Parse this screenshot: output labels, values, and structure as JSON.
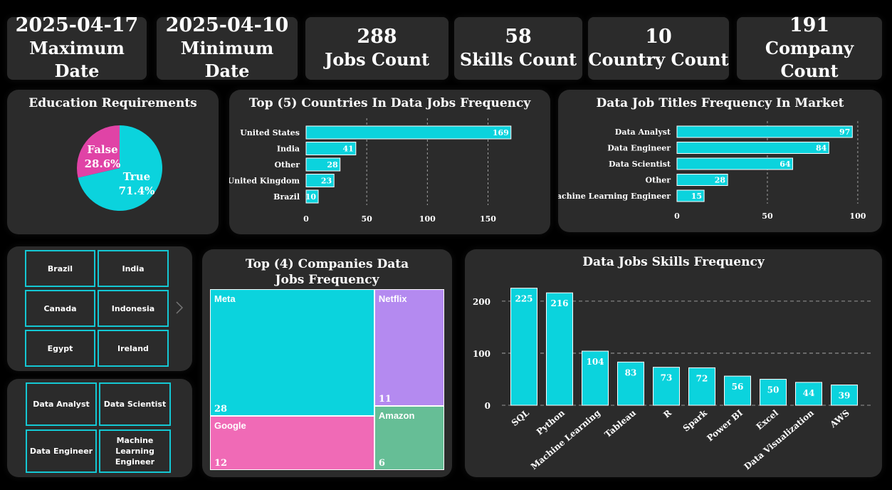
{
  "kpis": [
    {
      "value": "2025-04-17",
      "label": "Maximum Date"
    },
    {
      "value": "2025-04-10",
      "label": "Minimum Date"
    },
    {
      "value": "288",
      "label": "Jobs Count"
    },
    {
      "value": "58",
      "label": "Skills Count"
    },
    {
      "value": "10",
      "label": "Country Count"
    },
    {
      "value": "191",
      "label": "Company Count"
    }
  ],
  "panels": {
    "education": "Education Requirements",
    "countries": "Top (5) Countries In Data Jobs Frequency",
    "titles": "Data Job Titles Frequency In Market",
    "companies": "Top (4) Companies Data Jobs Frequency",
    "skills": "Data Jobs Skills Frequency"
  },
  "country_slicer": [
    "Brazil",
    "India",
    "Canada",
    "Indonesia",
    "Egypt",
    "Ireland"
  ],
  "title_slicer": [
    "Data Analyst",
    "Data Scientist",
    "Data Engineer",
    "Machine Learning Engineer"
  ],
  "colors": {
    "cyan": "#0bd3dd",
    "pink": "#e043a6",
    "purple": "#b48af0",
    "treepink": "#f06ab6",
    "green": "#66be96",
    "card": "#2b2b2b",
    "border": "#14c8d4"
  },
  "chart_data": [
    {
      "type": "pie",
      "title": "Education Requirements",
      "labels": [
        "True",
        "False"
      ],
      "values": [
        71.4,
        28.6
      ],
      "value_labels": [
        "71.4%",
        "28.6%"
      ]
    },
    {
      "type": "bar",
      "orientation": "horizontal",
      "title": "Top (5) Countries In Data Jobs Frequency",
      "categories": [
        "United States",
        "India",
        "Other",
        "United Kingdom",
        "Brazil"
      ],
      "values": [
        169,
        41,
        28,
        23,
        10
      ],
      "xlim": [
        0,
        175
      ],
      "ticks": [
        "0",
        "50",
        "100",
        "150"
      ],
      "grid": true
    },
    {
      "type": "bar",
      "orientation": "horizontal",
      "title": "Data Job Titles Frequency In Market",
      "categories": [
        "Data Analyst",
        "Data Engineer",
        "Data Scientist",
        "Other",
        "Machine Learning Engineer"
      ],
      "values": [
        97,
        84,
        64,
        28,
        15
      ],
      "xlim": [
        0,
        102
      ],
      "ticks": [
        "0",
        "50",
        "100"
      ],
      "grid": true
    },
    {
      "type": "treemap",
      "title": "Top (4) Companies Data Jobs Frequency",
      "categories": [
        "Meta",
        "Google",
        "Netflix",
        "Amazon"
      ],
      "values": [
        28,
        12,
        11,
        6
      ]
    },
    {
      "type": "bar",
      "title": "Data Jobs Skills Frequency",
      "categories": [
        "SQL",
        "Python",
        "Machine Learning",
        "Tableau",
        "R",
        "Spark",
        "Power BI",
        "Excel",
        "Data Visualization",
        "AWS"
      ],
      "values": [
        225,
        216,
        104,
        83,
        73,
        72,
        56,
        50,
        44,
        39
      ],
      "ylim": [
        0,
        245
      ],
      "ticks": [
        "0",
        "100",
        "200"
      ],
      "grid": true
    }
  ]
}
